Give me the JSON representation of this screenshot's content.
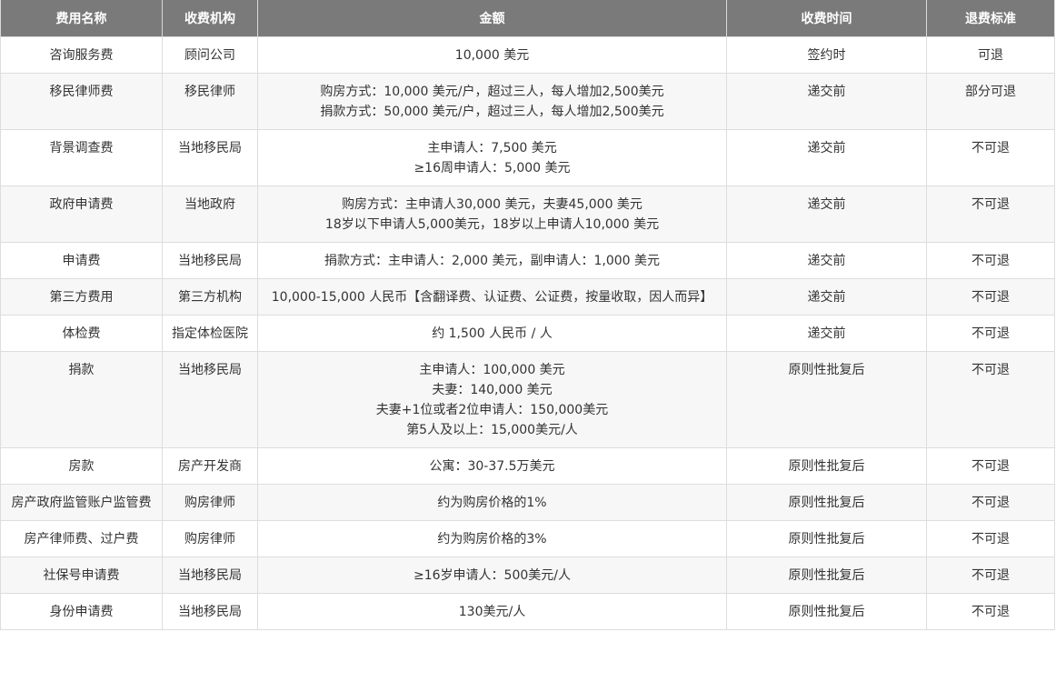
{
  "table": {
    "headers": [
      "费用名称",
      "收费机构",
      "金额",
      "收费时间",
      "退费标准"
    ],
    "rows": [
      {
        "name": "咨询服务费",
        "org": "顾问公司",
        "amount": [
          "10,000 美元"
        ],
        "time": "签约时",
        "refund": "可退"
      },
      {
        "name": "移民律师费",
        "org": "移民律师",
        "amount": [
          "购房方式：10,000 美元/户，超过三人，每人增加2,500美元",
          "捐款方式：50,000 美元/户，超过三人，每人增加2,500美元"
        ],
        "time": "递交前",
        "refund": "部分可退"
      },
      {
        "name": "背景调查费",
        "org": "当地移民局",
        "amount": [
          "主申请人：7,500 美元",
          "≥16周申请人：5,000 美元"
        ],
        "time": "递交前",
        "refund": "不可退"
      },
      {
        "name": "政府申请费",
        "org": "当地政府",
        "amount": [
          "购房方式：主申请人30,000 美元，夫妻45,000 美元",
          "18岁以下申请人5,000美元，18岁以上申请人10,000 美元"
        ],
        "time": "递交前",
        "refund": "不可退"
      },
      {
        "name": "申请费",
        "org": "当地移民局",
        "amount": [
          "捐款方式：主申请人：2,000 美元，副申请人：1,000 美元"
        ],
        "time": "递交前",
        "refund": "不可退"
      },
      {
        "name": "第三方费用",
        "org": "第三方机构",
        "amount": [
          "10,000-15,000 人民币【含翻译费、认证费、公证费，按量收取，因人而异】"
        ],
        "time": "递交前",
        "refund": "不可退"
      },
      {
        "name": "体检费",
        "org": "指定体检医院",
        "amount": [
          "约 1,500 人民币 / 人"
        ],
        "time": "递交前",
        "refund": "不可退"
      },
      {
        "name": "捐款",
        "org": "当地移民局",
        "amount": [
          "主申请人：100,000 美元",
          "夫妻：140,000 美元",
          "夫妻+1位或者2位申请人：150,000美元",
          "第5人及以上：15,000美元/人"
        ],
        "time": "原则性批复后",
        "refund": "不可退"
      },
      {
        "name": "房款",
        "org": "房产开发商",
        "amount": [
          "公寓：30-37.5万美元"
        ],
        "time": "原则性批复后",
        "refund": "不可退"
      },
      {
        "name": "房产政府监管账户监管费",
        "org": "购房律师",
        "amount": [
          "约为购房价格的1%"
        ],
        "time": "原则性批复后",
        "refund": "不可退"
      },
      {
        "name": "房产律师费、过户费",
        "org": "购房律师",
        "amount": [
          "约为购房价格的3%"
        ],
        "time": "原则性批复后",
        "refund": "不可退"
      },
      {
        "name": "社保号申请费",
        "org": "当地移民局",
        "amount": [
          "≥16岁申请人：500美元/人"
        ],
        "time": "原则性批复后",
        "refund": "不可退"
      },
      {
        "name": "身份申请费",
        "org": "当地移民局",
        "amount": [
          "130美元/人"
        ],
        "time": "原则性批复后",
        "refund": "不可退"
      }
    ]
  }
}
